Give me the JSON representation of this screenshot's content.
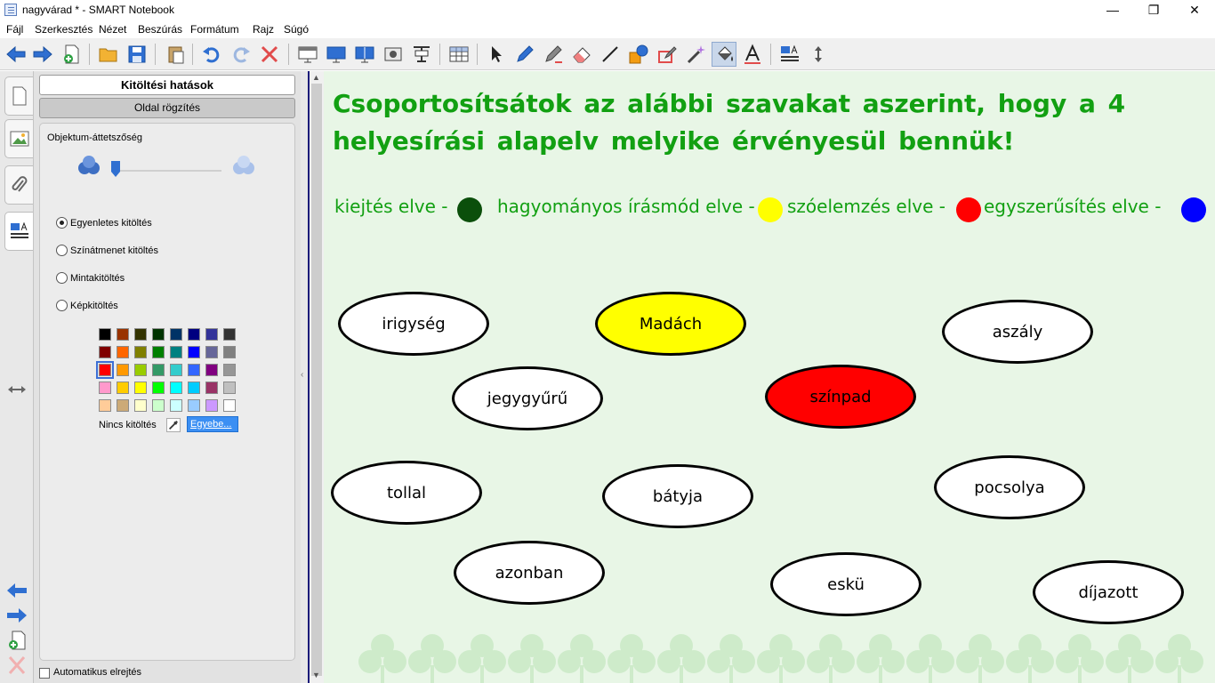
{
  "window": {
    "title": "nagyvárad * - SMART Notebook"
  },
  "menu": [
    "Fájl",
    "Szerkesztés",
    "Nézet",
    "Beszúrás",
    "Formátum",
    "Rajz",
    "Súgó"
  ],
  "panel": {
    "title": "Kitöltési hatások",
    "page_recording": "Oldal rögzítés",
    "transparency_label": "Objektum-áttetszőség",
    "fill_options": [
      "Egyenletes kitöltés",
      "Színátmenet kitöltés",
      "Mintakitöltés",
      "Képkitöltés"
    ],
    "selected_fill": "Egyenletes kitöltés",
    "no_fill": "Nincs kitöltés",
    "more": "Egyebe...",
    "auto_hide": "Automatikus elrejtés",
    "palette": [
      [
        "#000000",
        "#993300",
        "#333300",
        "#003300",
        "#003366",
        "#000080",
        "#333399",
        "#333333"
      ],
      [
        "#800000",
        "#ff6600",
        "#808000",
        "#008000",
        "#008080",
        "#0000ff",
        "#666699",
        "#808080"
      ],
      [
        "#ff0000",
        "#ff9900",
        "#99cc00",
        "#339966",
        "#33cccc",
        "#3366ff",
        "#800080",
        "#969696"
      ],
      [
        "#ff99cc",
        "#ffcc00",
        "#ffff00",
        "#00ff00",
        "#00ffff",
        "#00ccff",
        "#993366",
        "#c0c0c0"
      ],
      [
        "#ffcc99",
        "#ccaa77",
        "#ffffcc",
        "#ccffcc",
        "#ccffff",
        "#99ccff",
        "#cc99ff",
        "#ffffff"
      ]
    ],
    "selected_swatch": "#ff0000"
  },
  "content": {
    "heading": "Csoportosítsátok az alábbi szavakat aszerint, hogy a 4 helyesírási alapelv melyike érvényesül bennük!",
    "legend": [
      {
        "label": "kiejtés elve -",
        "color": "#0b4f0b"
      },
      {
        "label": "hagyományos írásmód elve -",
        "color": "#ffff00"
      },
      {
        "label": "szóelemzés elve -",
        "color": "#ff0000"
      },
      {
        "label": "egyszerűsítés elve -",
        "color": "#0000ff"
      }
    ],
    "words": [
      {
        "text": "irigység",
        "fill": "#ffffff"
      },
      {
        "text": "Madách",
        "fill": "#ffff00"
      },
      {
        "text": "aszály",
        "fill": "#ffffff"
      },
      {
        "text": "jegygyűrű",
        "fill": "#ffffff"
      },
      {
        "text": "színpad",
        "fill": "#ff0000"
      },
      {
        "text": "tollal",
        "fill": "#ffffff"
      },
      {
        "text": "bátyja",
        "fill": "#ffffff"
      },
      {
        "text": "pocsolya",
        "fill": "#ffffff"
      },
      {
        "text": "azonban",
        "fill": "#ffffff"
      },
      {
        "text": "eskü",
        "fill": "#ffffff"
      },
      {
        "text": "díjazott",
        "fill": "#ffffff"
      }
    ]
  },
  "colors": {
    "heading_green": "#12a012",
    "page_background": "#e8f6e6"
  },
  "toolbar_icons": [
    "back-arrow-icon",
    "forward-arrow-icon",
    "add-page-icon",
    "open-folder-icon",
    "save-icon",
    "paste-icon",
    "undo-icon",
    "redo-icon",
    "delete-icon",
    "screen-shade-icon",
    "display-icon",
    "document-camera-icon",
    "table-icon",
    "select-icon",
    "pen-icon",
    "creative-pen-icon",
    "eraser-icon",
    "line-icon",
    "shapes-icon",
    "magic-pen-icon",
    "fill-icon",
    "text-icon",
    "properties-icon",
    "move-toolbar-icon"
  ]
}
